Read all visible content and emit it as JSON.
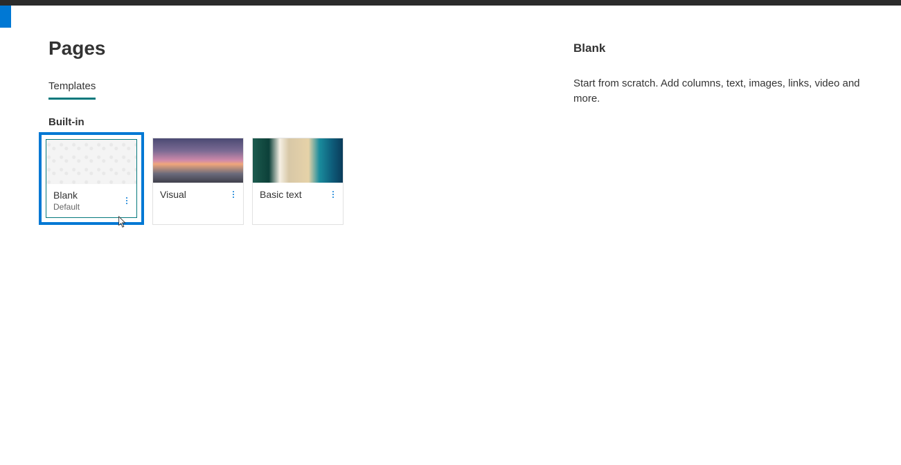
{
  "header": {
    "title": "Pages"
  },
  "tabs": [
    {
      "label": "Templates",
      "active": true
    }
  ],
  "section": {
    "label": "Built-in"
  },
  "cards": [
    {
      "title": "Blank",
      "subtitle": "Default",
      "selected": true,
      "thumb": "blank"
    },
    {
      "title": "Visual",
      "subtitle": "",
      "selected": false,
      "thumb": "visual"
    },
    {
      "title": "Basic text",
      "subtitle": "",
      "selected": false,
      "thumb": "basic"
    }
  ],
  "detail": {
    "title": "Blank",
    "description": "Start from scratch. Add columns, text, images, links, video and more."
  }
}
